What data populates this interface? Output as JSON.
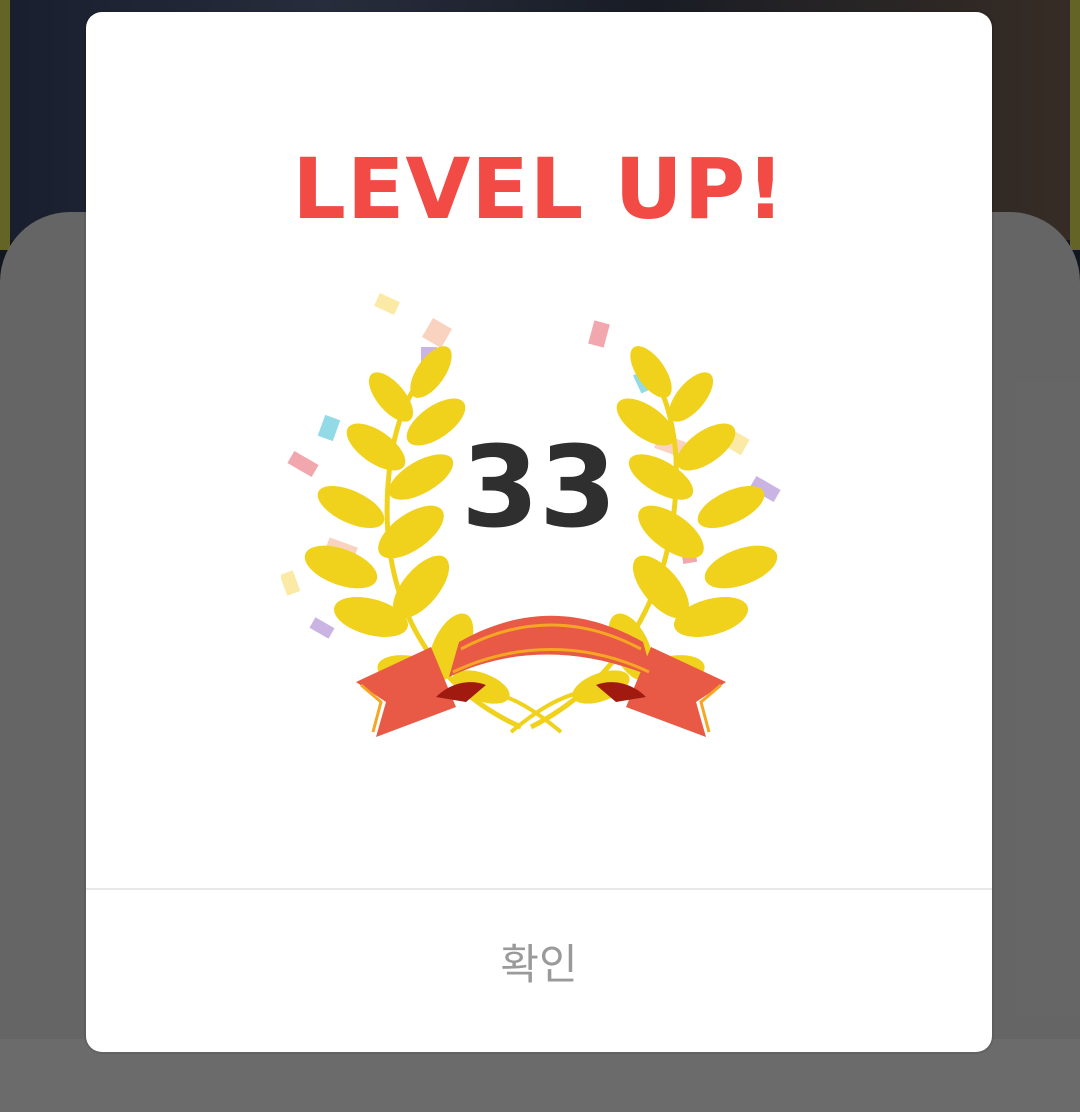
{
  "dialog": {
    "title": "LEVEL UP!",
    "level": "33",
    "confirm_label": "확인"
  },
  "colors": {
    "title": "#f24a45",
    "laurel": "#f0d21c",
    "ribbon": "#e85a45",
    "number": "#2f2f2f"
  },
  "icons": {
    "badge": "laurel-wreath-icon",
    "ribbon": "ribbon-banner-icon"
  }
}
